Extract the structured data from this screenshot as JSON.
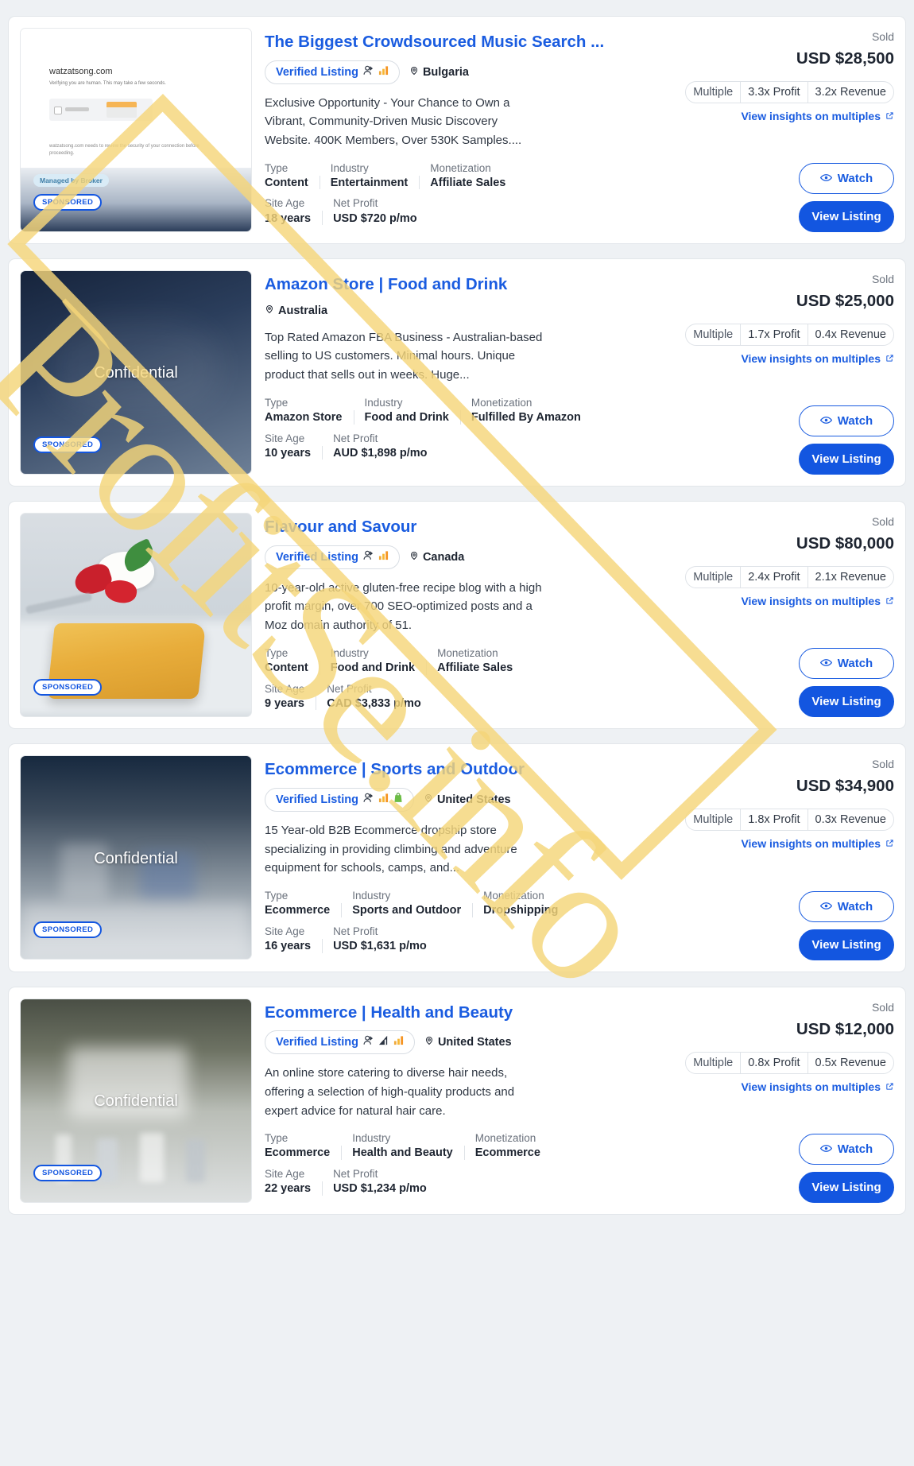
{
  "labels": {
    "type": "Type",
    "industry": "Industry",
    "monetization": "Monetization",
    "site_age": "Site Age",
    "net_profit": "Net Profit",
    "multiple": "Multiple",
    "insights": "View insights on multiples",
    "watch": "Watch",
    "view_listing": "View Listing",
    "verified": "Verified Listing",
    "confidential": "Confidential",
    "sponsored": "SPONSORED",
    "managed_by_broker": "Managed by Broker"
  },
  "colors": {
    "accent_blue": "#1a5ce0",
    "button_blue": "#1356e0",
    "watermark_gold": "#f5d67a",
    "text_dark": "#1d2430",
    "text_muted": "#6b727d"
  },
  "watermark": {
    "text": "ProfitSe.info"
  },
  "listings": [
    {
      "title": "The Biggest Crowdsourced Music Search ...",
      "verified": true,
      "badge_icons": [
        "verified-person-icon",
        "chart-bars-icon"
      ],
      "location": "Bulgaria",
      "description": "Exclusive Opportunity - Your Chance to Own a Vibrant, Community-Driven Music Discovery Website. 400K Members, Over 530K Samples....",
      "type": "Content",
      "industry": "Entertainment",
      "monetization": "Affiliate Sales",
      "site_age": "18 years",
      "net_profit": "USD $720 p/mo",
      "status": "Sold",
      "price": "USD $28,500",
      "profit_multiple": "3.3x Profit",
      "revenue_multiple": "3.2x Revenue",
      "thumb": "watzatsong",
      "thumb_caption": "",
      "sponsored": true,
      "managed_by_broker": true,
      "thumb_text": {
        "domain": "watzatsong.com",
        "sub": "Verifying you are human. This may take a few seconds.",
        "footer": "watzatsong.com needs to review the security of your connection before proceeding."
      }
    },
    {
      "title": "Amazon Store | Food and Drink",
      "verified": false,
      "badge_icons": [],
      "location": "Australia",
      "description": "Top Rated Amazon FBA Business - Australian-based selling to US customers. Minimal hours. Unique product that sells out in weeks. Huge...",
      "type": "Amazon Store",
      "industry": "Food and Drink",
      "monetization": "Fulfilled By Amazon",
      "site_age": "10 years",
      "net_profit": "AUD $1,898 p/mo",
      "status": "Sold",
      "price": "USD $25,000",
      "profit_multiple": "1.7x Profit",
      "revenue_multiple": "0.4x Revenue",
      "thumb": "dark",
      "thumb_caption": "Confidential",
      "sponsored": true,
      "managed_by_broker": false
    },
    {
      "title": "Flavour and Savour",
      "verified": true,
      "badge_icons": [
        "verified-person-icon",
        "chart-bars-icon"
      ],
      "location": "Canada",
      "description": "10-year-old active gluten-free recipe blog with a high profit margin, over 700 SEO-optimized posts and a Moz domain authority of 51.",
      "type": "Content",
      "industry": "Food and Drink",
      "monetization": "Affiliate Sales",
      "site_age": "9 years",
      "net_profit": "CAD $3,833 p/mo",
      "status": "Sold",
      "price": "USD $80,000",
      "profit_multiple": "2.4x Profit",
      "revenue_multiple": "2.1x Revenue",
      "thumb": "cake",
      "thumb_caption": "",
      "sponsored": true,
      "managed_by_broker": false
    },
    {
      "title": "Ecommerce | Sports and Outdoor",
      "verified": true,
      "badge_icons": [
        "verified-person-icon",
        "chart-bars-icon",
        "shopify-bag-icon"
      ],
      "location": "United States",
      "description": "15 Year-old B2B Ecommerce dropship store specializing in providing climbing and adventure equipment for schools, camps, and...",
      "type": "Ecommerce",
      "industry": "Sports and Outdoor",
      "monetization": "Dropshipping",
      "site_age": "16 years",
      "net_profit": "USD $1,631 p/mo",
      "status": "Sold",
      "price": "USD $34,900",
      "profit_multiple": "1.8x Profit",
      "revenue_multiple": "0.3x Revenue",
      "thumb": "sports",
      "thumb_caption": "Confidential",
      "sponsored": true,
      "managed_by_broker": false
    },
    {
      "title": "Ecommerce | Health and Beauty",
      "verified": true,
      "badge_icons": [
        "verified-person-icon",
        "chart-bars-dark-icon",
        "chart-bars-icon"
      ],
      "location": "United States",
      "description": "An online store catering to diverse hair needs, offering a selection of high-quality products and expert advice for natural hair care.",
      "type": "Ecommerce",
      "industry": "Health and Beauty",
      "monetization": "Ecommerce",
      "site_age": "22 years",
      "net_profit": "USD $1,234 p/mo",
      "status": "Sold",
      "price": "USD $12,000",
      "profit_multiple": "0.8x Profit",
      "revenue_multiple": "0.5x Revenue",
      "thumb": "beauty",
      "thumb_caption": "Confidential",
      "sponsored": true,
      "managed_by_broker": false
    }
  ]
}
